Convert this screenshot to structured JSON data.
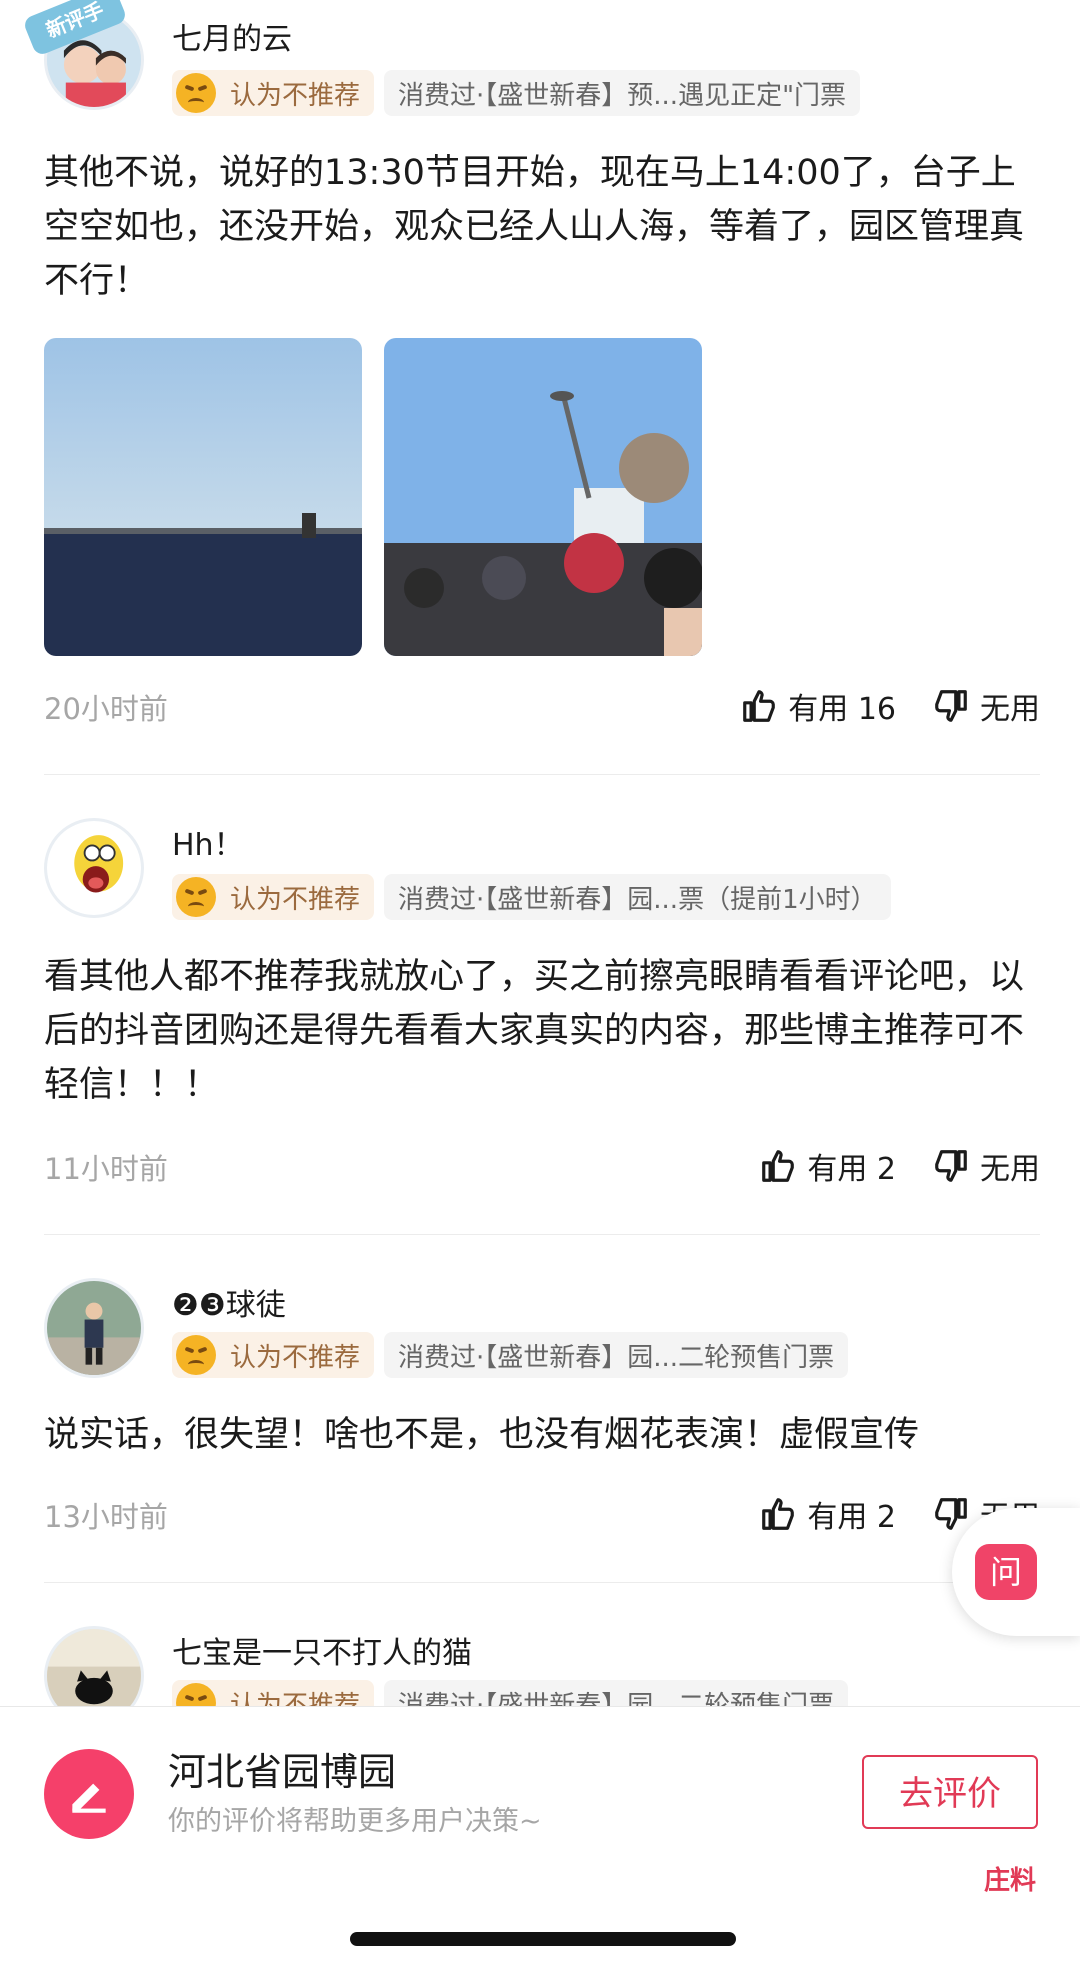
{
  "reviews": [
    {
      "username": "七月的云",
      "badge": "新评手",
      "verdict": "认为不推荐",
      "consumption": "消费过·【盛世新春】预...遇见正定\"门票",
      "content": "其他不说，说好的13:30节目开始，现在马上14:00了，台子上空空如也，还没开始，观众已经人山人海，等着了，园区管理真不行！",
      "time": "20小时前",
      "useful": "有用 16",
      "useless": "无用"
    },
    {
      "username": "Hh！",
      "verdict": "认为不推荐",
      "consumption": "消费过·【盛世新春】园...票（提前1小时）",
      "content": "看其他人都不推荐我就放心了，买之前擦亮眼睛看看评论吧，以后的抖音团购还是得先看看大家真实的内容，那些博主推荐可不轻信！！！",
      "time": "11小时前",
      "useful": "有用 2",
      "useless": "无用"
    },
    {
      "username": "❷❸球徒",
      "verdict": "认为不推荐",
      "consumption": "消费过·【盛世新春】园...二轮预售门票",
      "content": "说实话，很失望！啥也不是，也没有烟花表演！虚假宣传",
      "time": "13小时前",
      "useful": "有用 2",
      "useless": "无用"
    },
    {
      "username": "七宝是一只不打人的猫",
      "verdict": "认为不推荐",
      "consumption": "消费过·【盛世新春】园...二轮预售门票"
    }
  ],
  "float_button": "问",
  "bottom_bar": {
    "venue_name": "河北省园博园",
    "subtitle": "你的评价将帮助更多用户决策~",
    "review_button": "去评价"
  },
  "watermark": "庄料",
  "colors": {
    "accent": "#e13a56",
    "verdict_bg": "#fbf1e6",
    "verdict_text": "#9b6a3e"
  }
}
